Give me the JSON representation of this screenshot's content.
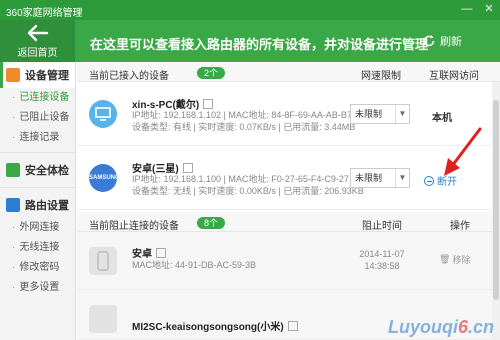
{
  "window": {
    "title": "360家庭网络管理",
    "minimize": "—",
    "close": "✕"
  },
  "header": {
    "back_label": "返回首页",
    "message": "在这里可以查看接入路由器的所有设备，并对设备进行管理",
    "refresh_label": "刷新"
  },
  "sidebar": {
    "sections": [
      {
        "label": "设备管理",
        "icon": "device-icon",
        "color": "#f08a2c",
        "items": [
          "已连接设备",
          "已阻止设备",
          "连接记录"
        ]
      },
      {
        "label": "安全体检",
        "icon": "shield-icon",
        "color": "#3aa846",
        "items": []
      },
      {
        "label": "路由设置",
        "icon": "gear-icon",
        "color": "#2a7fd4",
        "items": [
          "外网连接",
          "无线连接",
          "修改密码",
          "更多设置"
        ]
      }
    ]
  },
  "connected": {
    "heading": "当前已接入的设备",
    "count": "2个",
    "col_speed": "网速限制",
    "col_access": "互联网访问",
    "devices": [
      {
        "name": "xin-s-PC(戴尔)",
        "line1": "IP地址: 192.168.1.102 | MAC地址: 84-8F-69-AA-AB-B7",
        "line2": "设备类型: 有线 | 实时速度: 0.07KB/s | 已用流量: 3.44MB",
        "speed": "未限制",
        "access": "本机"
      },
      {
        "name": "安卓(三星)",
        "line1": "IP地址: 192.168.1.100 | MAC地址: F0-27-65-F4-C9-27",
        "line2": "设备类型: 无线 | 实时速度: 0.00KB/s | 已用流量: 206.93KB",
        "speed": "未限制",
        "access": "断开",
        "brand": "SAMSUNG"
      }
    ]
  },
  "blocked": {
    "heading": "当前阻止连接的设备",
    "count": "8个",
    "col_time": "阻止时间",
    "col_action": "操作",
    "devices": [
      {
        "name": "安卓",
        "line1": "MAC地址: 44-91-DB-AC-59-3B",
        "date": "2014-11-07",
        "time": "14:38:58",
        "action": "移除"
      },
      {
        "name": "MI2SC-keaisongsongsong(小米)"
      }
    ]
  },
  "watermark": {
    "left": "Luyouqi",
    "six": "6",
    "right": ".cn"
  },
  "colors": {
    "brand_green": "#3aa846",
    "link_blue": "#2a7fd4",
    "arrow_red": "#e02020"
  }
}
